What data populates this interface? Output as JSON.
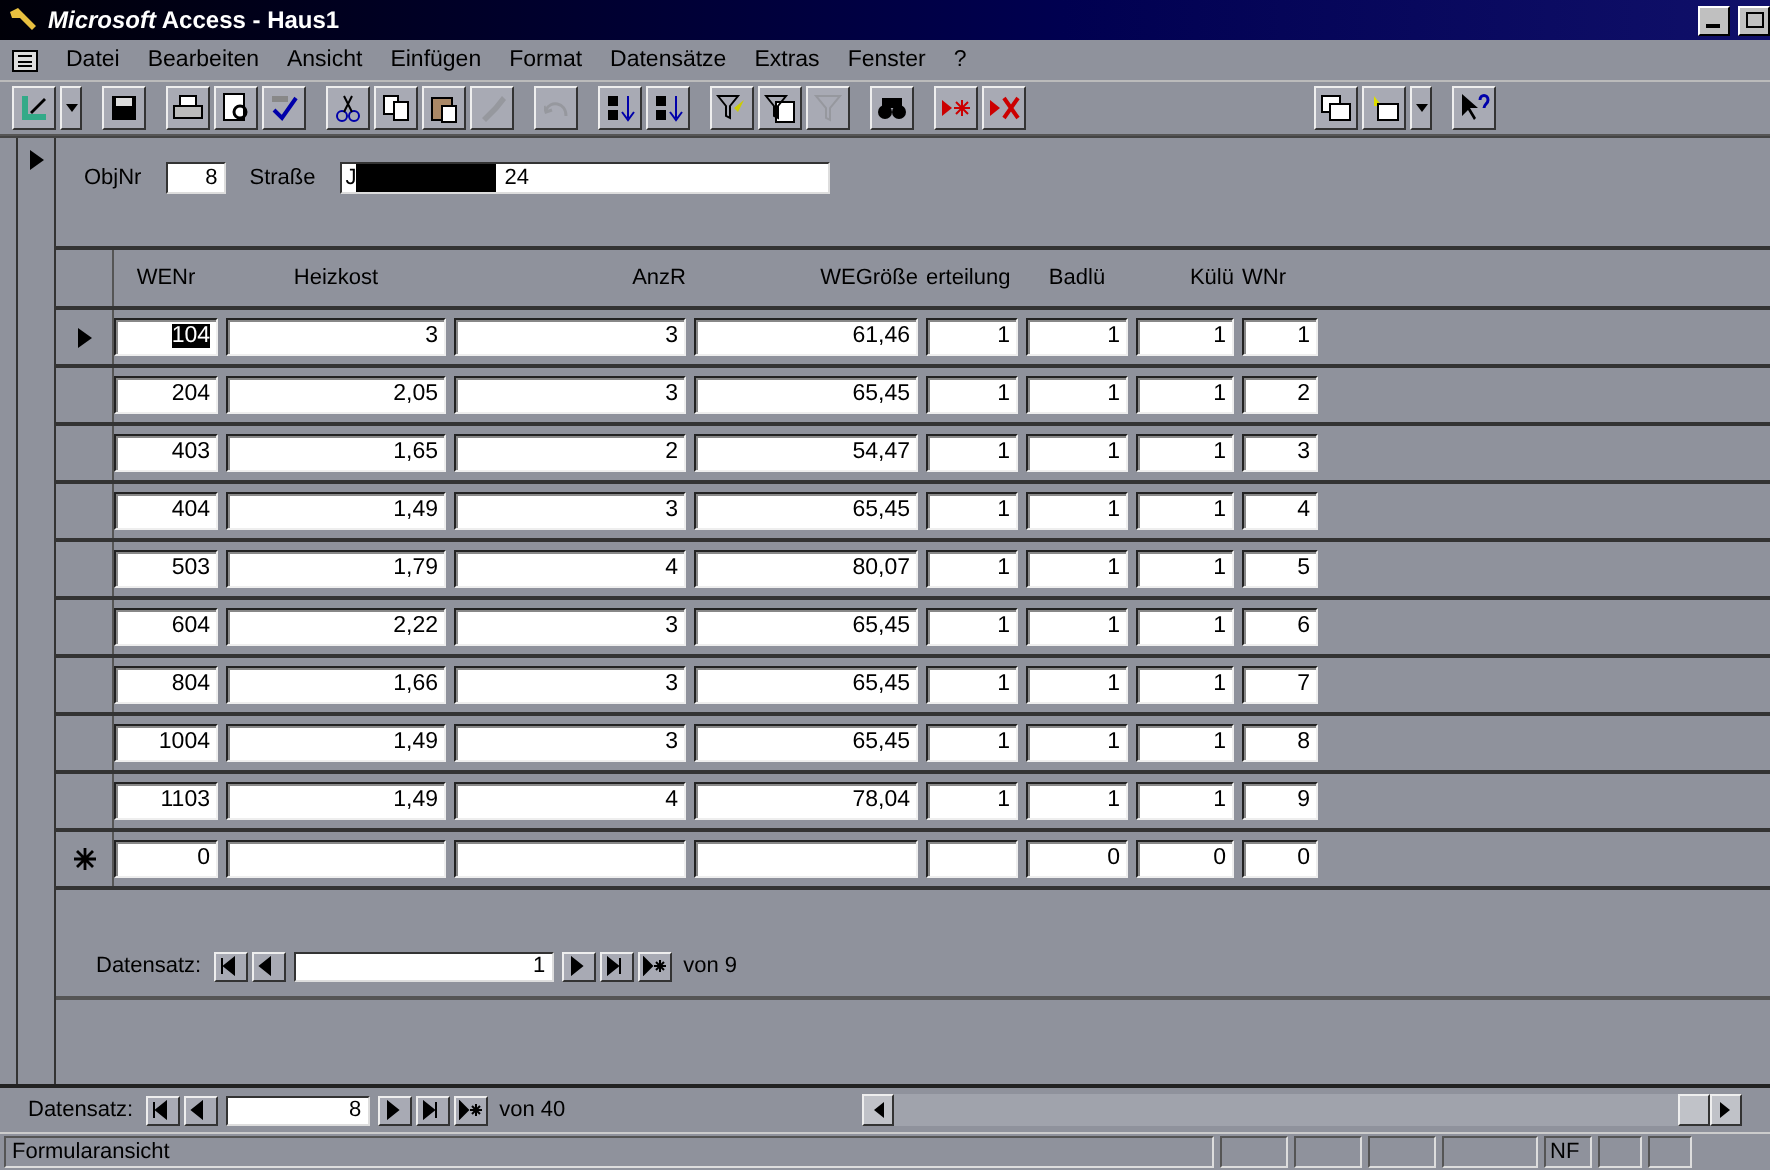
{
  "window": {
    "title": "*Microsoft* Access - Haus1"
  },
  "menu": [
    "Datei",
    "Bearbeiten",
    "Ansicht",
    "Einfügen",
    "Format",
    "Datensätze",
    "Extras",
    "Fenster",
    "?"
  ],
  "toolbar": {
    "left": [
      [
        {
          "kind": "design",
          "disabled": false
        },
        {
          "kind": "dropdown",
          "disabled": false
        }
      ],
      [
        {
          "kind": "save",
          "disabled": false
        }
      ],
      [
        {
          "kind": "print",
          "disabled": false
        },
        {
          "kind": "preview",
          "disabled": false
        },
        {
          "kind": "spell",
          "disabled": false
        }
      ],
      [
        {
          "kind": "cut",
          "disabled": false
        },
        {
          "kind": "copy",
          "disabled": false
        },
        {
          "kind": "paste",
          "disabled": false
        },
        {
          "kind": "brush",
          "disabled": true
        }
      ],
      [
        {
          "kind": "undo",
          "disabled": true
        }
      ],
      [
        {
          "kind": "sortasc",
          "disabled": false
        },
        {
          "kind": "sortdesc",
          "disabled": false
        }
      ],
      [
        {
          "kind": "filtersel",
          "disabled": false
        },
        {
          "kind": "filterform",
          "disabled": false
        },
        {
          "kind": "filter",
          "disabled": true
        }
      ],
      [
        {
          "kind": "find",
          "disabled": false
        }
      ],
      [
        {
          "kind": "newrec",
          "disabled": false
        },
        {
          "kind": "delrec",
          "disabled": false
        }
      ]
    ],
    "right": [
      [
        {
          "kind": "window",
          "disabled": false
        },
        {
          "kind": "newobj",
          "disabled": false
        },
        {
          "kind": "dropdown",
          "disabled": false
        }
      ],
      [
        {
          "kind": "help",
          "disabled": false
        }
      ]
    ]
  },
  "form": {
    "fields": [
      {
        "label": "ObjNr",
        "value": "8",
        "kind": "number"
      },
      {
        "label": "Straße",
        "value_start": "J",
        "value_end": "24",
        "kind": "redacted"
      }
    ]
  },
  "subform": {
    "columns": [
      "WENr",
      "Heizkost",
      "AnzR",
      "WEGröße",
      "erteilung",
      "Badlü",
      "Külü",
      "WNr"
    ],
    "rows": [
      {
        "selected": true,
        "kind": "data",
        "cells": [
          "104",
          "3",
          "3",
          "61,46",
          "1",
          "1",
          "1",
          "1"
        ]
      },
      {
        "selected": false,
        "kind": "data",
        "cells": [
          "204",
          "2,05",
          "3",
          "65,45",
          "1",
          "1",
          "1",
          "2"
        ]
      },
      {
        "selected": false,
        "kind": "data",
        "cells": [
          "403",
          "1,65",
          "2",
          "54,47",
          "1",
          "1",
          "1",
          "3"
        ]
      },
      {
        "selected": false,
        "kind": "data",
        "cells": [
          "404",
          "1,49",
          "3",
          "65,45",
          "1",
          "1",
          "1",
          "4"
        ]
      },
      {
        "selected": false,
        "kind": "data",
        "cells": [
          "503",
          "1,79",
          "4",
          "80,07",
          "1",
          "1",
          "1",
          "5"
        ]
      },
      {
        "selected": false,
        "kind": "data",
        "cells": [
          "604",
          "2,22",
          "3",
          "65,45",
          "1",
          "1",
          "1",
          "6"
        ]
      },
      {
        "selected": false,
        "kind": "data",
        "cells": [
          "804",
          "1,66",
          "3",
          "65,45",
          "1",
          "1",
          "1",
          "7"
        ]
      },
      {
        "selected": false,
        "kind": "data",
        "cells": [
          "1004",
          "1,49",
          "3",
          "65,45",
          "1",
          "1",
          "1",
          "8"
        ]
      },
      {
        "selected": false,
        "kind": "data",
        "cells": [
          "1103",
          "1,49",
          "4",
          "78,04",
          "1",
          "1",
          "1",
          "9"
        ]
      },
      {
        "selected": false,
        "kind": "new",
        "cells": [
          "0",
          null,
          null,
          null,
          null,
          "0",
          "0",
          "0"
        ]
      }
    ],
    "navigator": {
      "label": "Datensatz:",
      "current": "1",
      "total": "von 9"
    }
  },
  "navigator": {
    "label": "Datensatz:",
    "current": "8",
    "total": "von 40"
  },
  "status_bar": {
    "text": "Formularansicht",
    "indicator": "NF"
  }
}
